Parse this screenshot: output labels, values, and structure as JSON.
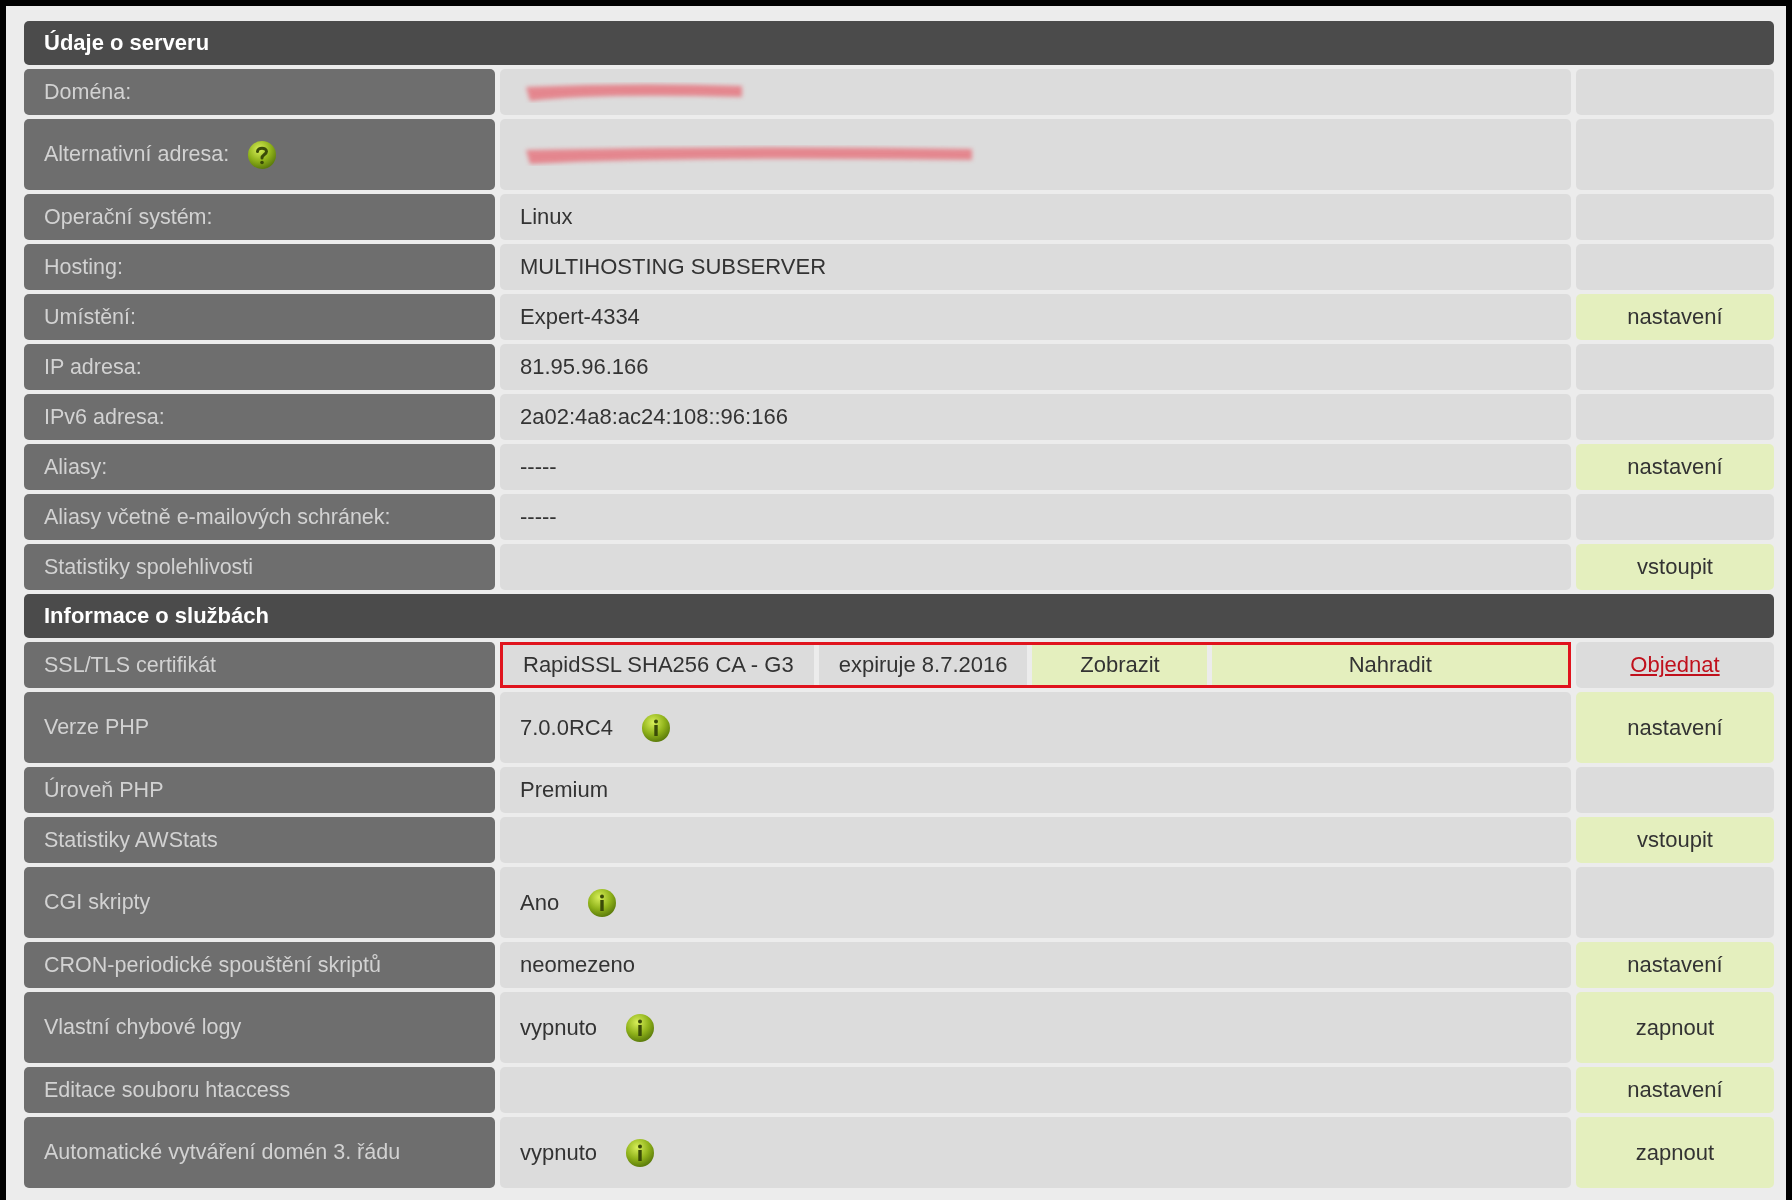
{
  "sections": [
    {
      "title": "Údaje o serveru",
      "rows": [
        {
          "label": "Doména:",
          "value": {
            "kind": "redacted"
          }
        },
        {
          "label": "Alternativní adresa:",
          "hint": {
            "kind": "help"
          },
          "value": {
            "kind": "redacted"
          }
        },
        {
          "label": "Operační systém:",
          "value": {
            "kind": "text",
            "text": "Linux"
          }
        },
        {
          "label": "Hosting:",
          "value": {
            "kind": "text",
            "text": "MULTIHOSTING SUBSERVER"
          }
        },
        {
          "label": "Umístění:",
          "value": {
            "kind": "text",
            "text": "Expert-4334"
          },
          "action": {
            "label": "nastavení",
            "kind": "button"
          }
        },
        {
          "label": "IP adresa:",
          "value": {
            "kind": "text",
            "text": "81.95.96.166"
          }
        },
        {
          "label": "IPv6 adresa:",
          "value": {
            "kind": "text",
            "text": "2a02:4a8:ac24:108::96:166"
          }
        },
        {
          "label": "Aliasy:",
          "value": {
            "kind": "text",
            "text": "-----"
          },
          "action": {
            "label": "nastavení",
            "kind": "button"
          }
        },
        {
          "label": "Aliasy včetně e-mailových schránek:",
          "value": {
            "kind": "text",
            "text": "-----"
          }
        },
        {
          "label": "Statistiky spolehlivosti",
          "action": {
            "label": "vstoupit",
            "kind": "button"
          }
        }
      ]
    },
    {
      "title": "Informace o službách",
      "rows": [
        {
          "label": "SSL/TLS certifikát",
          "value": {
            "kind": "segments",
            "highlighted": true,
            "segments": [
              {
                "text": "RapidSSL SHA256 CA - G3",
                "kind": "text"
              },
              {
                "text": "expiruje 8.7.2016",
                "kind": "text"
              },
              {
                "text": "Zobrazit",
                "kind": "button"
              },
              {
                "text": "Nahradit",
                "kind": "button"
              }
            ]
          },
          "action": {
            "label": "Objednat",
            "kind": "link"
          }
        },
        {
          "label": "Verze PHP",
          "value": {
            "kind": "text",
            "text": "7.0.0RC4"
          },
          "hint": {
            "kind": "info"
          },
          "action": {
            "label": "nastavení",
            "kind": "button"
          }
        },
        {
          "label": "Úroveň PHP",
          "value": {
            "kind": "text",
            "text": "Premium"
          }
        },
        {
          "label": "Statistiky AWStats",
          "action": {
            "label": "vstoupit",
            "kind": "button"
          }
        },
        {
          "label": "CGI skripty",
          "value": {
            "kind": "text",
            "text": "Ano"
          },
          "hint": {
            "kind": "info"
          }
        },
        {
          "label": "CRON-periodické spouštění skriptů",
          "value": {
            "kind": "text",
            "text": "neomezeno"
          },
          "action": {
            "label": "nastavení",
            "kind": "button"
          }
        },
        {
          "label": "Vlastní chybové logy",
          "value": {
            "kind": "text",
            "text": "vypnuto"
          },
          "hint": {
            "kind": "info"
          },
          "action": {
            "label": "zapnout",
            "kind": "button"
          }
        },
        {
          "label": "Editace souboru htaccess",
          "action": {
            "label": "nastavení",
            "kind": "button"
          }
        },
        {
          "label": "Automatické vytváření domén 3. řádu",
          "value": {
            "kind": "text",
            "text": "vypnuto"
          },
          "hint": {
            "kind": "info"
          },
          "action": {
            "label": "zapnout",
            "kind": "button"
          }
        }
      ]
    }
  ]
}
